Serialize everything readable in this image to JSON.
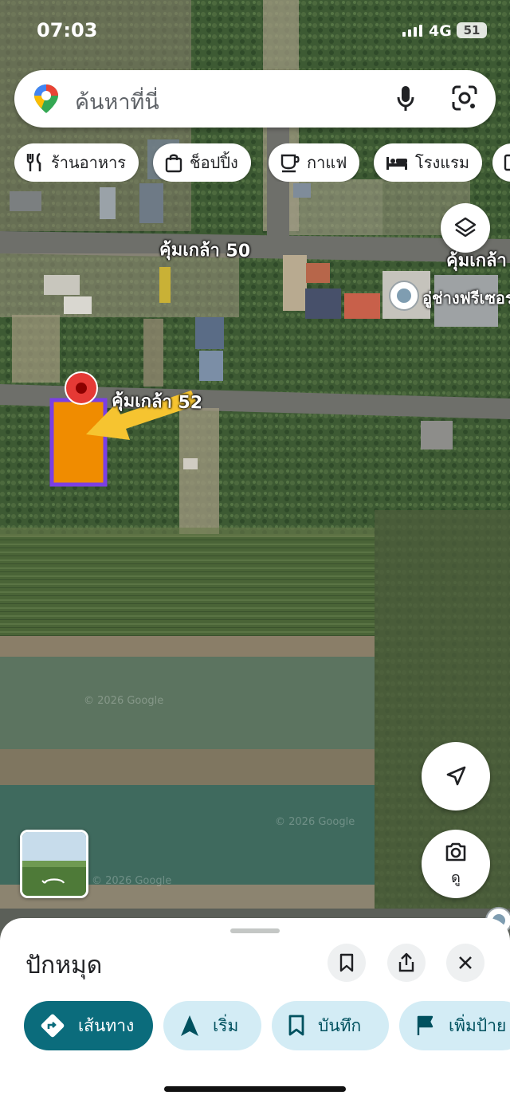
{
  "status_bar": {
    "time": "07:03",
    "network": "4G",
    "battery": "51"
  },
  "search": {
    "placeholder": "ค้นหาที่นี่"
  },
  "chips": [
    {
      "label": "ร้านอาหาร",
      "icon": "restaurant-icon"
    },
    {
      "label": "ช็อปปิ้ง",
      "icon": "shopping-bag-icon"
    },
    {
      "label": "กาแฟ",
      "icon": "coffee-icon"
    },
    {
      "label": "โรงแรม",
      "icon": "hotel-bed-icon"
    }
  ],
  "map": {
    "road_labels": [
      "คุ้มเกล้า 50",
      "คุ้มเกล้า",
      "คุ้มเกล้า 52"
    ],
    "poi_label": "อู่ช่างฟรีเซอร",
    "copyright": "© 2026 Google",
    "colors": {
      "marker_red": "#e53935",
      "parcel_fill": "#f08c00",
      "parcel_border": "#7b3fe4",
      "arrow": "#f6c430"
    }
  },
  "fab": {
    "lens_label": "ดู"
  },
  "sheet": {
    "title": "ปักหมุด",
    "actions": {
      "directions": "เส้นทาง",
      "start": "เริ่ม",
      "save": "บันทึก",
      "add_label": "เพิ่มป้าย"
    },
    "accent": "#0b6c7c"
  }
}
